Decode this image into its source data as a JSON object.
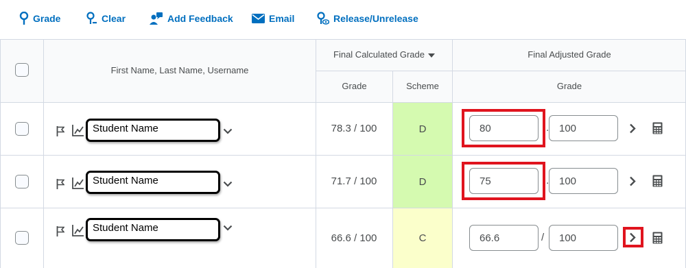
{
  "toolbar": {
    "grade": "Grade",
    "clear": "Clear",
    "add_feedback": "Add Feedback",
    "email": "Email",
    "release": "Release/Unrelease",
    "accent_color": "#006fbf"
  },
  "table": {
    "name_header": "First Name, Last Name, Username",
    "final_calc_header": "Final Calculated Grade",
    "final_adj_header": "Final Adjusted Grade",
    "sub_grade": "Grade",
    "sub_scheme": "Scheme",
    "sub_adj_grade": "Grade"
  },
  "rows": [
    {
      "name": "Student Name",
      "calc_grade": "78.3 / 100",
      "scheme": "D",
      "scheme_color": "#d5fab0",
      "adj_value": "80",
      "adj_out_of": "100",
      "separator": ".",
      "highlight": "adjusted-value"
    },
    {
      "name": "Student Name",
      "calc_grade": "71.7 / 100",
      "scheme": "D",
      "scheme_color": "#d5fab0",
      "adj_value": "75",
      "adj_out_of": "100",
      "separator": ".",
      "highlight": "adjusted-value"
    },
    {
      "name": "Student Name",
      "calc_grade": "66.6 / 100",
      "scheme": "C",
      "scheme_color": "#fbffcb",
      "adj_value": "66.6",
      "adj_out_of": "100",
      "separator": "/",
      "highlight": "expand-button"
    }
  ],
  "highlight_color": "#e0141e"
}
